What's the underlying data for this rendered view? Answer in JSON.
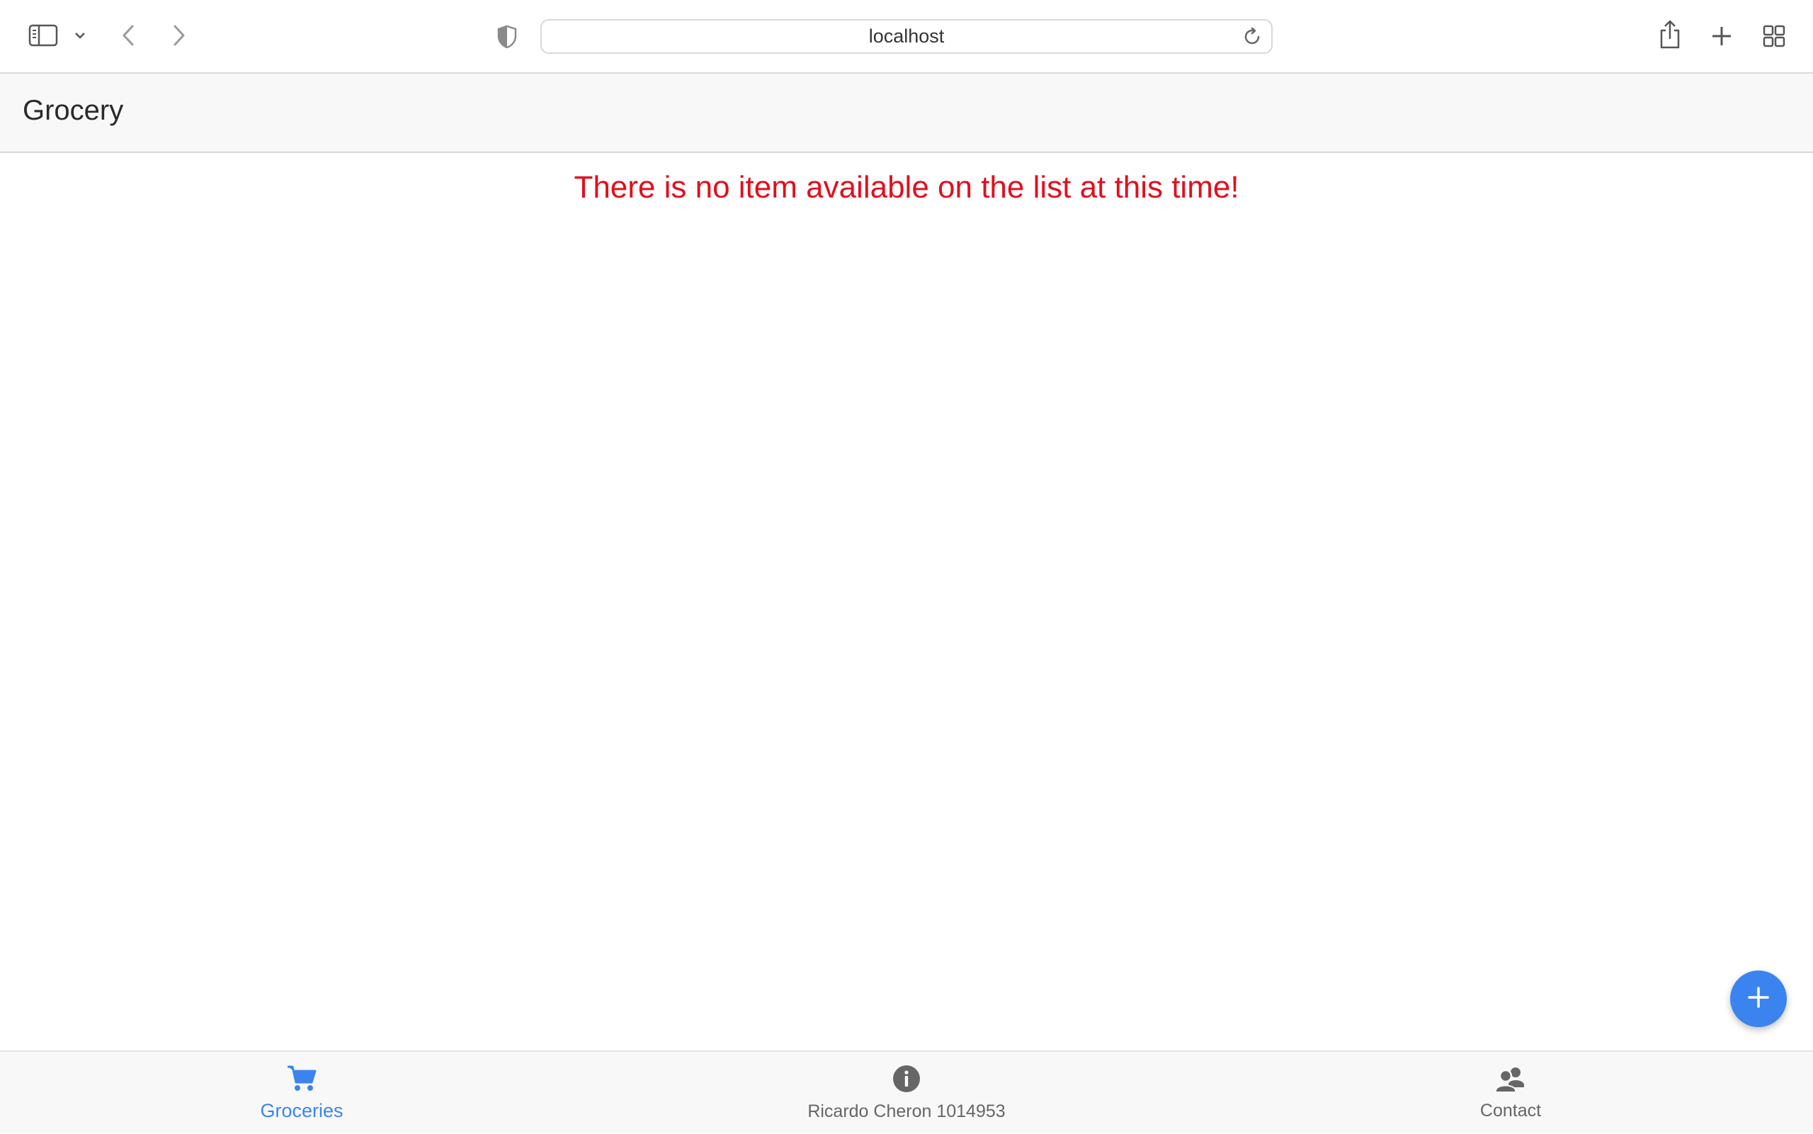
{
  "browser": {
    "url": "localhost"
  },
  "header": {
    "title": "Grocery"
  },
  "main": {
    "empty_message": "There is no item available on the list at this time!"
  },
  "tabs": [
    {
      "label": "Groceries",
      "icon": "cart-icon",
      "active": true
    },
    {
      "label": "Ricardo Cheron 1014953",
      "icon": "info-icon",
      "active": false
    },
    {
      "label": "Contact",
      "icon": "people-icon",
      "active": false
    }
  ],
  "fab": {
    "icon": "plus-icon"
  },
  "colors": {
    "accent": "#3b84f0",
    "error": "#e0101e",
    "inactive": "#666666"
  }
}
